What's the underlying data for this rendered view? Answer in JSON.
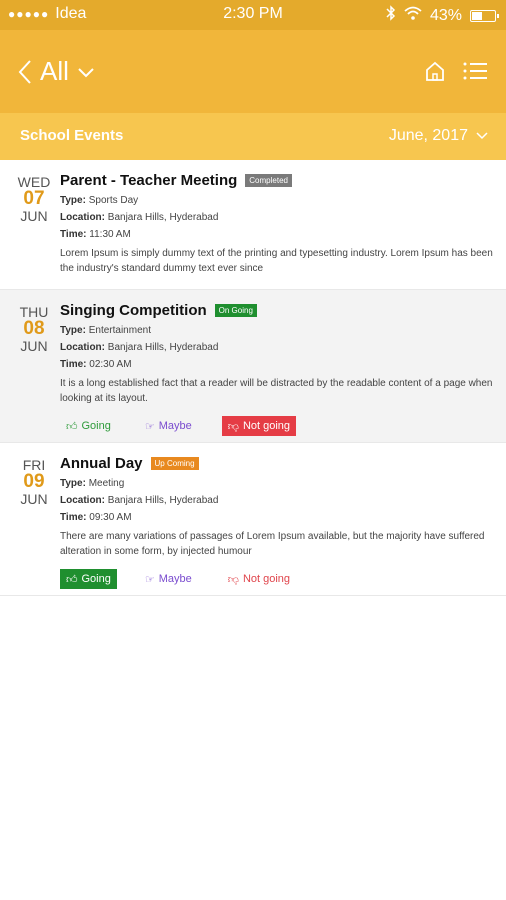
{
  "status_bar": {
    "carrier": "Idea",
    "signal_dots": "●●●●●",
    "time": "2:30 PM",
    "battery": "43%"
  },
  "header": {
    "back_label": "All",
    "home_icon": "home-icon",
    "menu_icon": "menu-icon"
  },
  "subbar": {
    "title": "School Events",
    "month": "June, 2017"
  },
  "events": [
    {
      "dow": "WED",
      "day": "07",
      "month": "JUN",
      "title": "Parent - Teacher Meeting",
      "status": "Completed",
      "status_color": "#7a7a7a",
      "type_label": "Type:",
      "type": "Sports Day",
      "location_label": "Location:",
      "location": "Banjara Hills, Hyderabad",
      "time_label": "Time:",
      "time": "11:30 AM",
      "description": "Lorem Ipsum is simply dummy text of the printing and typesetting industry. Lorem Ipsum has been the industry's standard dummy text ever since"
    },
    {
      "dow": "THU",
      "day": "08",
      "month": "JUN",
      "title": "Singing Competition",
      "status": "On Going",
      "status_color": "#1f8f2f",
      "type_label": "Type:",
      "type": "Entertainment",
      "location_label": "Location:",
      "location": "Banjara Hills, Hyderabad",
      "time_label": "Time:",
      "time": "02:30 AM",
      "description": "It is a long established fact that a reader will be distracted by the readable content of a page when looking at its layout.",
      "rsvp": {
        "going": "Going",
        "maybe": "Maybe",
        "not_going": "Not going",
        "selected": "not_going"
      }
    },
    {
      "dow": "FRI",
      "day": "09",
      "month": "JUN",
      "title": "Annual Day",
      "status": "Up Coming",
      "status_color": "#e8891f",
      "type_label": "Type:",
      "type": "Meeting",
      "location_label": "Location:",
      "location": "Banjara Hills, Hyderabad",
      "time_label": "Time:",
      "time": "09:30 AM",
      "description": "There are many variations of passages of Lorem Ipsum available, but the majority have suffered alteration in some form, by injected humour",
      "rsvp": {
        "going": "Going",
        "maybe": "Maybe",
        "not_going": "Not going",
        "selected": "going"
      }
    }
  ],
  "colors": {
    "status_bar": "#e4aa2c",
    "header": "#f1b63a",
    "subbar": "#f7c64f",
    "date_accent": "#e09a1a"
  }
}
